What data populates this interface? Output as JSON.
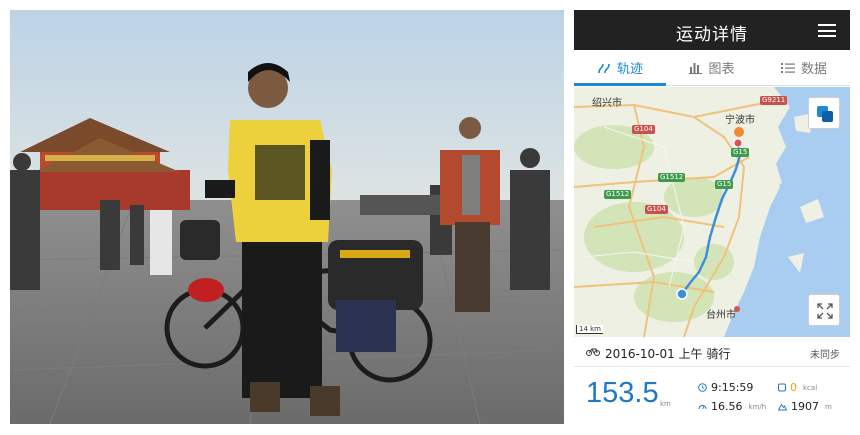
{
  "app": {
    "title": "运动详情"
  },
  "tabs": [
    {
      "label": "轨迹",
      "icon": "track-icon",
      "active": true
    },
    {
      "label": "图表",
      "icon": "bar-chart-icon",
      "active": false
    },
    {
      "label": "数据",
      "icon": "list-icon",
      "active": false
    }
  ],
  "map": {
    "cities": {
      "shaoxing": "绍兴市",
      "ningbo": "宁波市",
      "taizhou": "台州市"
    },
    "roads": {
      "g9211": "G9211",
      "g104_top": "G104",
      "g15": "G15",
      "g1512": "G1512",
      "g15_lower": "G15",
      "g1512_left": "G1512",
      "g104_lower": "G104"
    },
    "scale": "14 km",
    "route_color": "#3d8fd9",
    "sea_color": "#a8cdf0"
  },
  "activity": {
    "date": "2016-10-01 上午 骑行",
    "sync_status": "未同步",
    "distance": "153.5",
    "distance_unit": "km",
    "duration": "9:15:59",
    "speed": "16.56",
    "speed_unit": "km/h",
    "calories": "0",
    "calories_unit": "kcal",
    "elevation": "1907",
    "elevation_unit": "m"
  },
  "colors": {
    "accent": "#1d89d6",
    "distance": "#1d78c6",
    "titlebar": "#222222",
    "calories": "#e8a317"
  }
}
